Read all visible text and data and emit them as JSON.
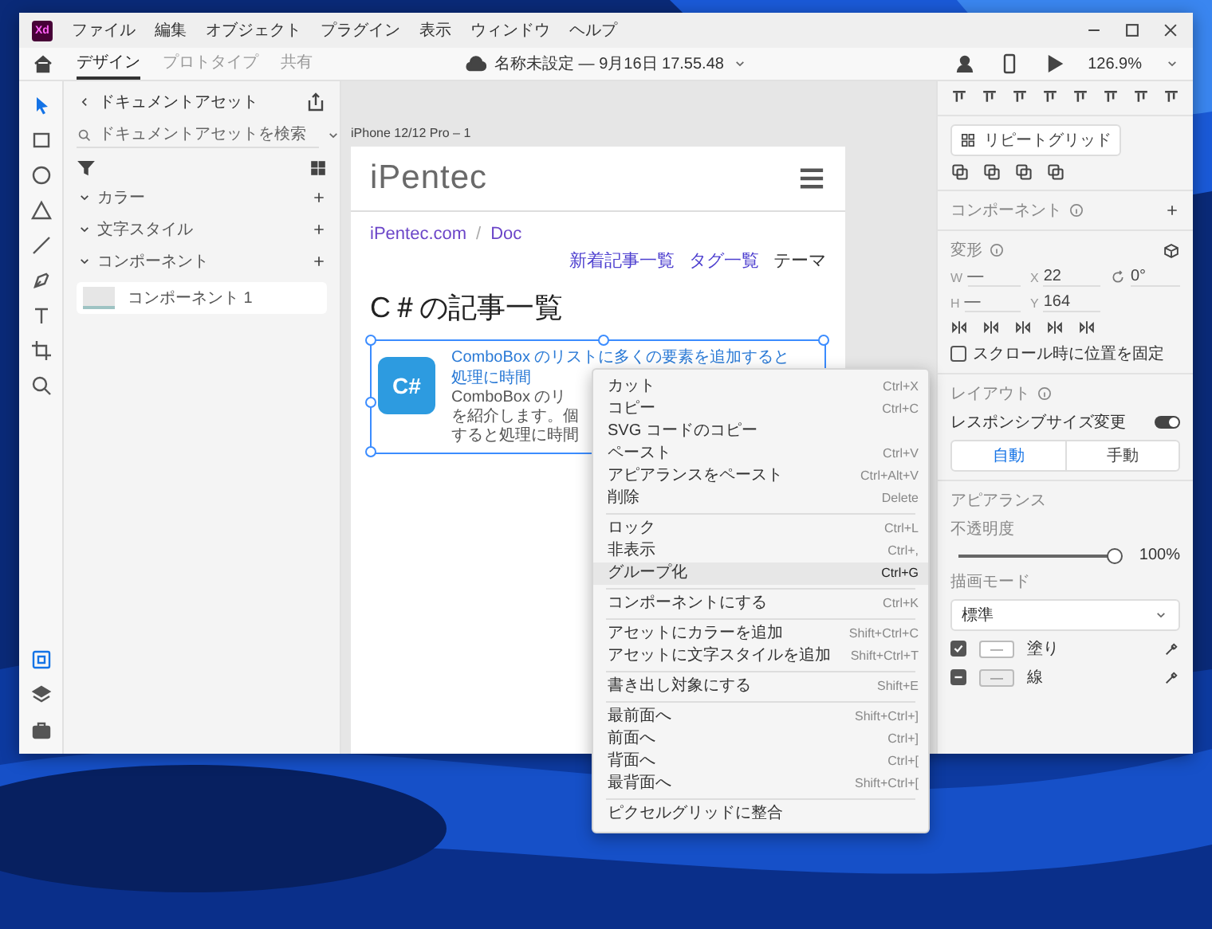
{
  "app": {
    "logo": "Xd",
    "menus": [
      "ファイル",
      "編集",
      "オブジェクト",
      "プラグイン",
      "表示",
      "ウィンドウ",
      "ヘルプ"
    ]
  },
  "tabs": [
    {
      "label": "デザイン",
      "selected": true
    },
    {
      "label": "プロトタイプ",
      "selected": false
    },
    {
      "label": "共有",
      "selected": false
    }
  ],
  "document_title": "名称未設定 — 9月16日 17.55.48",
  "zoom": "126.9%",
  "tools": [
    {
      "kind": "select",
      "selected": true
    },
    {
      "kind": "rectangle",
      "selected": false
    },
    {
      "kind": "ellipse",
      "selected": false
    },
    {
      "kind": "triangle",
      "selected": false
    },
    {
      "kind": "line",
      "selected": false
    },
    {
      "kind": "pen",
      "selected": false
    },
    {
      "kind": "text",
      "selected": false
    },
    {
      "kind": "artboard",
      "selected": false
    },
    {
      "kind": "zoom",
      "selected": false
    }
  ],
  "rail_bottom": [
    {
      "kind": "assets",
      "selected": true
    },
    {
      "kind": "layers",
      "selected": false
    },
    {
      "kind": "plugins",
      "selected": false
    }
  ],
  "assets": {
    "title": "ドキュメントアセット",
    "search_placeholder": "ドキュメントアセットを検索",
    "sections": [
      {
        "label": "カラー",
        "expanded": true
      },
      {
        "label": "文字スタイル",
        "expanded": true
      },
      {
        "label": "コンポーネント",
        "expanded": true
      }
    ],
    "components": [
      "コンポーネント 1"
    ]
  },
  "artboard": {
    "label": "iPhone 12/12 Pro – 1",
    "logo": "iPentec",
    "breadcrumb": [
      "iPentec.com",
      "Doc"
    ],
    "breadcrumb_separator": "/",
    "nav": [
      {
        "label": "新着記事一覧",
        "kind": "link"
      },
      {
        "label": "タグ一覧",
        "kind": "link"
      },
      {
        "label": "テーマ",
        "kind": "plain"
      }
    ],
    "heading": "C＃の記事一覧",
    "card": {
      "icon_text": "C#",
      "title": [
        "ComboBox のリストに多くの要素を追加すると",
        "処理に時間"
      ],
      "summary": [
        "ComboBox のリ",
        "を紹介します。個",
        "すると処理に時間"
      ]
    }
  },
  "context_menu": [
    [
      {
        "label": "カット",
        "shortcut": "Ctrl+X",
        "selected": false
      },
      {
        "label": "コピー",
        "shortcut": "Ctrl+C",
        "selected": false
      },
      {
        "label": "SVG コードのコピー",
        "selected": false
      },
      {
        "label": "ペースト",
        "shortcut": "Ctrl+V",
        "selected": false
      },
      {
        "label": "アピアランスをペースト",
        "shortcut": "Ctrl+Alt+V",
        "selected": false
      },
      {
        "label": "削除",
        "shortcut": "Delete",
        "selected": false
      }
    ],
    [
      {
        "label": "ロック",
        "shortcut": "Ctrl+L",
        "selected": false
      },
      {
        "label": "非表示",
        "shortcut": "Ctrl+,",
        "selected": false
      },
      {
        "label": "グループ化",
        "shortcut": "Ctrl+G",
        "selected": true
      }
    ],
    [
      {
        "label": "コンポーネントにする",
        "shortcut": "Ctrl+K",
        "selected": false
      }
    ],
    [
      {
        "label": "アセットにカラーを追加",
        "shortcut": "Shift+Ctrl+C",
        "selected": false
      },
      {
        "label": "アセットに文字スタイルを追加",
        "shortcut": "Shift+Ctrl+T",
        "selected": false
      }
    ],
    [
      {
        "label": "書き出し対象にする",
        "shortcut": "Shift+E",
        "selected": false
      }
    ],
    [
      {
        "label": "最前面へ",
        "shortcut": "Shift+Ctrl+]",
        "selected": false
      },
      {
        "label": "前面へ",
        "shortcut": "Ctrl+]",
        "selected": false
      },
      {
        "label": "背面へ",
        "shortcut": "Ctrl+[",
        "selected": false
      },
      {
        "label": "最背面へ",
        "shortcut": "Shift+Ctrl+[",
        "selected": false
      }
    ],
    [
      {
        "label": "ピクセルグリッドに整合",
        "selected": false
      }
    ]
  ],
  "inspector": {
    "repeat_grid": "リピートグリッド",
    "component": {
      "label": "コンポーネント"
    },
    "transform": {
      "label": "変形",
      "width": {
        "label": "W",
        "value": "—"
      },
      "x": {
        "label": "X",
        "value": "22"
      },
      "rotation": "0°",
      "height": {
        "label": "H",
        "value": "—"
      },
      "y": {
        "label": "Y",
        "value": "164"
      },
      "fix_on_scroll": {
        "label": "スクロール時に位置を固定",
        "checked": false
      }
    },
    "layout": {
      "label": "レイアウト",
      "responsive": {
        "label": "レスポンシブサイズ変更",
        "on": true
      },
      "modes": [
        {
          "label": "自動",
          "selected": true
        },
        {
          "label": "手動",
          "selected": false
        }
      ]
    },
    "appearance": {
      "label": "アピアランス",
      "opacity": {
        "label": "不透明度",
        "level": 1,
        "reading": "100%"
      },
      "blend_mode": {
        "label": "描画モード",
        "value": "標準"
      },
      "layers": [
        {
          "label": "塗り",
          "swatch": "—",
          "checked": true,
          "mixed": false
        },
        {
          "label": "線",
          "swatch": "—",
          "checked": false,
          "mixed": true
        }
      ]
    }
  }
}
